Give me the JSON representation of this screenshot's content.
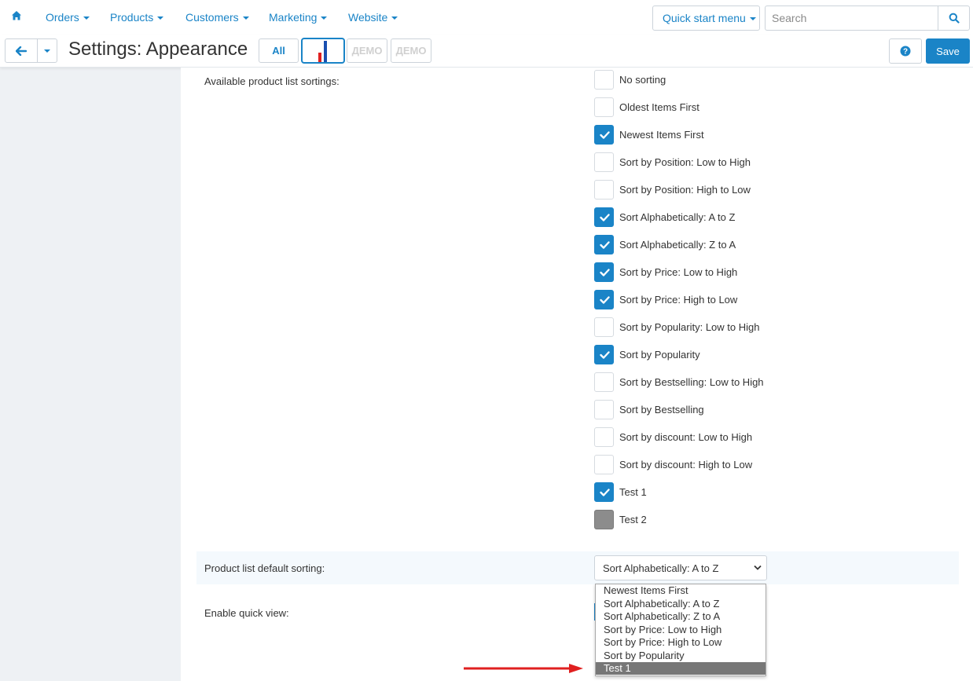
{
  "nav": {
    "items": [
      {
        "label": "Orders"
      },
      {
        "label": "Products"
      },
      {
        "label": "Customers"
      },
      {
        "label": "Marketing"
      },
      {
        "label": "Website"
      }
    ],
    "quick_start": "Quick start menu",
    "search_placeholder": "Search"
  },
  "header": {
    "title": "Settings: Appearance",
    "tab_all": "All",
    "demo_tab_1": "ДЕМО",
    "demo_tab_2": "ДЕМО",
    "save_label": "Save"
  },
  "form": {
    "sortings_label": "Available product list sortings:",
    "sortings": [
      {
        "label": "No sorting",
        "state": "unchecked"
      },
      {
        "label": "Oldest Items First",
        "state": "unchecked"
      },
      {
        "label": "Newest Items First",
        "state": "checked"
      },
      {
        "label": "Sort by Position: Low to High",
        "state": "unchecked"
      },
      {
        "label": "Sort by Position: High to Low",
        "state": "unchecked"
      },
      {
        "label": "Sort Alphabetically: A to Z",
        "state": "checked"
      },
      {
        "label": "Sort Alphabetically: Z to A",
        "state": "checked"
      },
      {
        "label": "Sort by Price: Low to High",
        "state": "checked"
      },
      {
        "label": "Sort by Price: High to Low",
        "state": "checked"
      },
      {
        "label": "Sort by Popularity: Low to High",
        "state": "unchecked"
      },
      {
        "label": "Sort by Popularity",
        "state": "checked"
      },
      {
        "label": "Sort by Bestselling: Low to High",
        "state": "unchecked"
      },
      {
        "label": "Sort by Bestselling",
        "state": "unchecked"
      },
      {
        "label": "Sort by discount: Low to High",
        "state": "unchecked"
      },
      {
        "label": "Sort by discount: High to Low",
        "state": "unchecked"
      },
      {
        "label": "Test 1",
        "state": "checked"
      },
      {
        "label": "Test 2",
        "state": "disabled"
      }
    ],
    "default_sorting_label": "Product list default sorting:",
    "default_sorting_value": "Sort Alphabetically: A to Z",
    "dropdown_options": [
      "Newest Items First",
      "Sort Alphabetically: A to Z",
      "Sort Alphabetically: Z to A",
      "Sort by Price: Low to High",
      "Sort by Price: High to Low",
      "Sort by Popularity",
      "Test 1"
    ],
    "dropdown_highlighted": "Test 1",
    "quick_view_label": "Enable quick view:"
  },
  "colors": {
    "accent": "#1a84c7",
    "annotation_arrow": "#e02020"
  }
}
